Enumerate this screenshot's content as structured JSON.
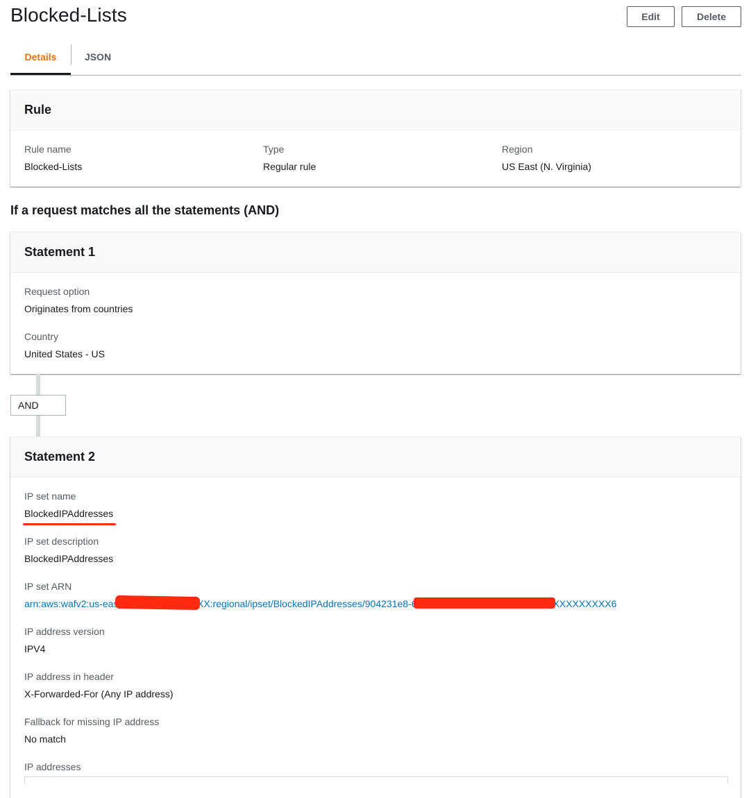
{
  "header": {
    "title": "Blocked-Lists",
    "edit_label": "Edit",
    "delete_label": "Delete"
  },
  "tabs": [
    {
      "label": "Details",
      "active": true
    },
    {
      "label": "JSON",
      "active": false
    }
  ],
  "rule_panel": {
    "title": "Rule",
    "fields": [
      {
        "label": "Rule name",
        "value": "Blocked-Lists"
      },
      {
        "label": "Type",
        "value": "Regular rule"
      },
      {
        "label": "Region",
        "value": "US East (N. Virginia)"
      }
    ]
  },
  "statements_heading": "If a request matches all the statements (AND)",
  "statement1": {
    "title": "Statement 1",
    "fields": [
      {
        "label": "Request option",
        "value": "Originates from countries"
      },
      {
        "label": "Country",
        "value": "United States - US"
      }
    ]
  },
  "and_label": "AND",
  "statement2": {
    "title": "Statement 2",
    "fields": [
      {
        "label": "IP set name",
        "value": "BlockedIPAddresses"
      },
      {
        "label": "IP set description",
        "value": "BlockedIPAddresses"
      },
      {
        "label": "IP set ARN",
        "value": "arn:aws:wafv2:us-east-1:XXXXXXXXXXXX:regional/ipset/BlockedIPAddresses/904231e8-6XXXXXXXXXXXXXXXXXXXXXXXXXXXXXX6"
      },
      {
        "label": "IP address version",
        "value": "IPV4"
      },
      {
        "label": "IP address in header",
        "value": "X-Forwarded-For (Any IP address)"
      },
      {
        "label": "Fallback for missing IP address",
        "value": "No match"
      },
      {
        "label": "IP addresses",
        "value": ""
      }
    ]
  },
  "colors": {
    "active_tab": "#ec7211",
    "link": "#0073bb",
    "redaction": "#ff2a0f"
  }
}
